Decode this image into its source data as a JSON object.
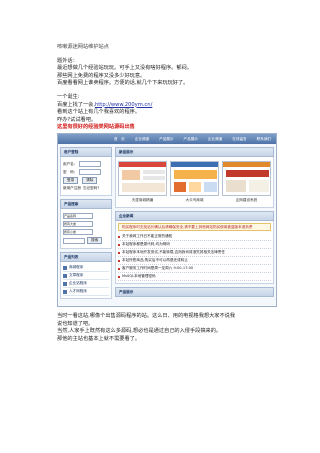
{
  "doc": {
    "header": "咳嗽源迷网站维护站点",
    "lines_top": [
      "题外话：",
      "最近想做几个经验站玩玩。可手上又没有啥好程序。郁闷。",
      "那些网上免费的程序又没多少好玩意。",
      "百度看看网上谁卖程序。方便的话,就几个下来玩玩好了。"
    ],
    "lines_mid": [
      "一个诞生:",
      "百度上找了一会,"
    ],
    "link": "http://www.200ym.cn/",
    "lines_mid2": [
      "看到这个站上有几个我喜欢的程序。",
      "咋办?试试看吧。"
    ],
    "red_line": "这里有很好的经验类网站源码出售",
    "lines_bottom": [
      "当时一看这站,哪像个出售源码程序的站。这么日、用的电视格我想大家不说我",
      "说也知道了吧。",
      "当然,人家手上既然有这么多源码,想必也是通过自己的入侵手段搞来的。",
      "那他的主站也基本上就不需要看了。"
    ]
  },
  "shot": {
    "nav": [
      "首　页",
      "企业频道",
      "产品展示",
      "产品展示",
      "企业频道",
      "在线留言",
      "联系我们"
    ],
    "left": {
      "login_title": "用户登陆",
      "username_label": "用户名：",
      "password_label": "密　码：",
      "btn_login": "登录",
      "btn_reset": "清除",
      "register": "新用户注册",
      "forgot": "忘记密码?",
      "search_title": "产品搜索",
      "sel1": "产品名称",
      "sel2": "所有大类",
      "sel3": "所有小类",
      "search_btn": "搜索",
      "cat_title": "产品列表",
      "cats": [
        "商城程序",
        "文章程序",
        "企业站程序",
        "人才网程序"
      ]
    },
    "main": {
      "new_title": "新品展示",
      "thumbs": [
        "天涯商城精编",
        "大众鸟商城",
        "企网建设系统"
      ],
      "news_title": "企业新闻",
      "notice": "购买程序时无找站长确认后请确保安全,请不要上其他网站购买使用被盗版本谁负责",
      "news": [
        "关于我网工作日不能正常的通知",
        "本站程序都是源代码,均为明码",
        "本站程序本地开发测试,不能转载,否则我司将追究其相关法律责任",
        "本站所售商品,购买后不可以再退还或转让",
        "客户服务工作时间是周一至周六 9:00-17:00",
        "MsSQL本地管理密码"
      ],
      "products_title": "产品展示"
    }
  }
}
